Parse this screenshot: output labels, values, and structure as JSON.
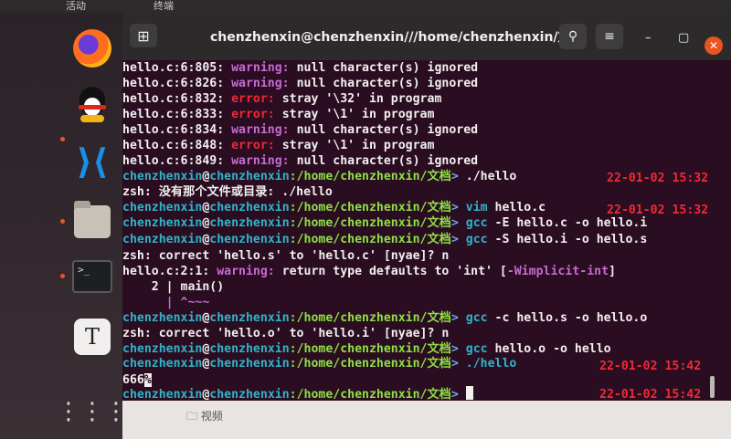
{
  "topbar": {
    "activities": "活动",
    "app": "终端"
  },
  "window": {
    "title": "chenzhenxin@chenzhenxin///home/chenzhenxin/文档",
    "newtab_icon": "⊞",
    "search_icon": "⚲",
    "menu_icon": "≡",
    "minimize_icon": "–",
    "maximize_icon": "▢",
    "close_icon": "✕"
  },
  "prompt": {
    "user": "chenzhenxin",
    "at": "@",
    "host": "chenzhenxin",
    "path": ":/home/chenzhenxin/文档",
    "caret": ">"
  },
  "lines": {
    "l1": {
      "loc": "hello.c:6:805:",
      "kind": "warning:",
      "msg": "null character(s) ignored"
    },
    "l2": {
      "loc": "hello.c:6:826:",
      "kind": "warning:",
      "msg": "null character(s) ignored"
    },
    "l3": {
      "loc": "hello.c:6:832:",
      "kind": "error:",
      "msg": "stray '\\32' in program"
    },
    "l4": {
      "loc": "hello.c:6:833:",
      "kind": "error:",
      "msg": "stray '\\1' in program"
    },
    "l5": {
      "loc": "hello.c:6:834:",
      "kind": "warning:",
      "msg": "null character(s) ignored"
    },
    "l6": {
      "loc": "hello.c:6:848:",
      "kind": "error:",
      "msg": "stray '\\1' in program"
    },
    "l7": {
      "loc": "hello.c:6:849:",
      "kind": "warning:",
      "msg": "null character(s) ignored"
    },
    "c1": {
      "cmd": "./hello",
      "time": "22-01-02 15:32"
    },
    "o1": "zsh: 没有那个文件或目录: ./hello",
    "c2": {
      "cmd_a": "vim",
      "cmd_b": " hello.c",
      "time": "22-01-02 15:32"
    },
    "c3": {
      "cmd_a": "gcc",
      "cmd_b": " -E hello.c -o hello.i"
    },
    "c4": {
      "cmd_a": "gcc",
      "cmd_b": " -S hello.i -o hello.s"
    },
    "o2": "zsh: correct 'hello.s' to 'hello.c' [nyae]? n",
    "o3": {
      "loc": "hello.c:2:1:",
      "kind": "warning:",
      "msg": "return type defaults to 'int' [",
      "flag": "-Wimplicit-int",
      "end": "]"
    },
    "o4": "    2 | main()",
    "o5": "      | ^~~~",
    "c5": {
      "cmd_a": "gcc",
      "cmd_b": " -c hello.s -o hello.o"
    },
    "o6": "zsh: correct 'hello.o' to 'hello.i' [nyae]? n",
    "c6": {
      "cmd_a": "gcc",
      "cmd_b": " hello.o -o hello"
    },
    "c7": {
      "cmd": "./hello",
      "time": "22-01-02 15:42"
    },
    "o7": "666",
    "o7_mark": "%",
    "c8": {
      "time": "22-01-02 15:42"
    }
  },
  "background": {
    "item": "视频"
  },
  "dock": {
    "firefox": "firefox-icon",
    "qq": "qq-icon",
    "vscode": "vscode-icon",
    "files": "files-icon",
    "terminal": "terminal-icon",
    "terminal_glyph": ">_",
    "typora": "typora-icon",
    "typora_glyph": "T"
  }
}
